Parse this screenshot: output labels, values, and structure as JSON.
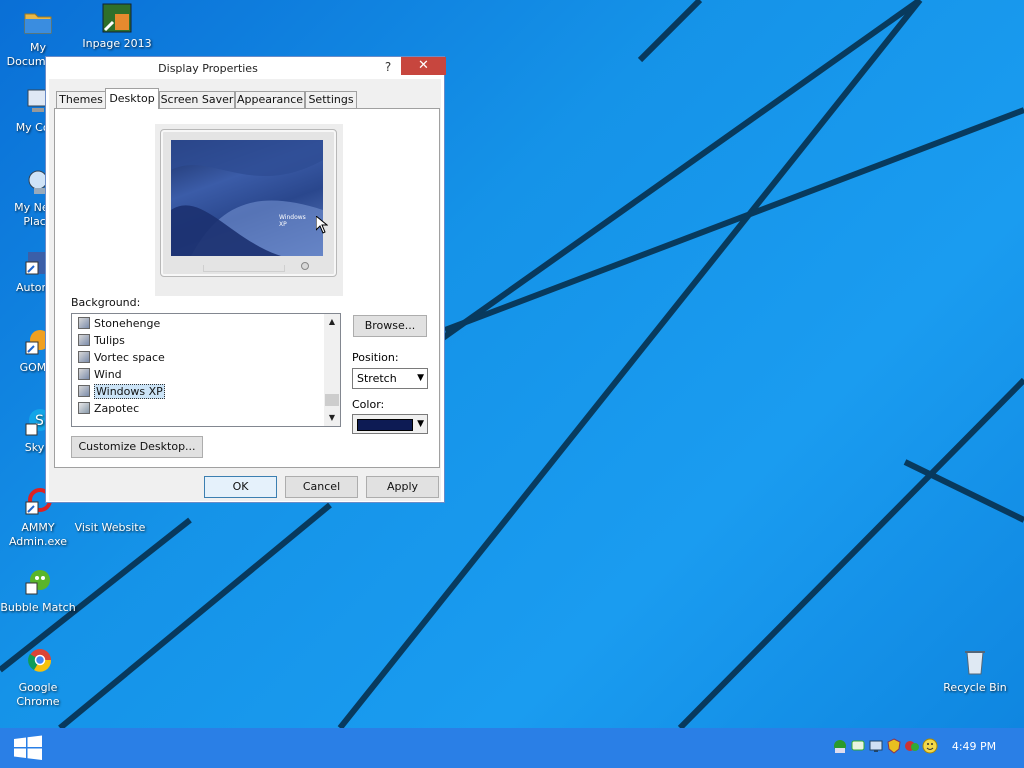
{
  "desktop": {
    "icons": [
      {
        "label": "My Documents"
      },
      {
        "label": "Inpage 2013"
      },
      {
        "label": "My Com"
      },
      {
        "label": "My Netw Place"
      },
      {
        "label": "Autorun"
      },
      {
        "label": "GOM P"
      },
      {
        "label": "Skyp"
      },
      {
        "label": "AMMY Admin.exe"
      },
      {
        "label": "Visit Website"
      },
      {
        "label": "Bubble Match"
      },
      {
        "label": "Google Chrome"
      },
      {
        "label": "Recycle Bin"
      }
    ]
  },
  "dialog": {
    "title": "Display Properties",
    "help_label": "?",
    "close_label": "✕",
    "tabs": [
      {
        "label": "Themes"
      },
      {
        "label": "Desktop"
      },
      {
        "label": "Screen Saver"
      },
      {
        "label": "Appearance"
      },
      {
        "label": "Settings"
      }
    ],
    "active_tab": "Desktop",
    "preview": {
      "screen_logo": "Windows XP"
    },
    "background_label": "Background:",
    "backgrounds": [
      {
        "name": "Stonehenge"
      },
      {
        "name": "Tulips"
      },
      {
        "name": "Vortec space"
      },
      {
        "name": "Wind"
      },
      {
        "name": "Windows XP"
      },
      {
        "name": "Zapotec"
      }
    ],
    "selected_background": "Windows XP",
    "browse_label": "Browse...",
    "position_label": "Position:",
    "position_value": "Stretch",
    "color_label": "Color:",
    "color_value": "#0d1b54",
    "customize_label": "Customize Desktop...",
    "ok_label": "OK",
    "cancel_label": "Cancel",
    "apply_label": "Apply"
  },
  "taskbar": {
    "start_icon": "windows-logo-icon",
    "tray_icons": [
      "network-icon",
      "chat-icon",
      "monitor-icon",
      "shield-icon",
      "security-icon",
      "smiley-icon"
    ],
    "clock": "4:49 PM"
  },
  "colors": {
    "desktop_blue": "#1593e8",
    "taskbar": "#2a7fe6",
    "close_button": "#c7463e",
    "selection": "#cce4f7"
  }
}
